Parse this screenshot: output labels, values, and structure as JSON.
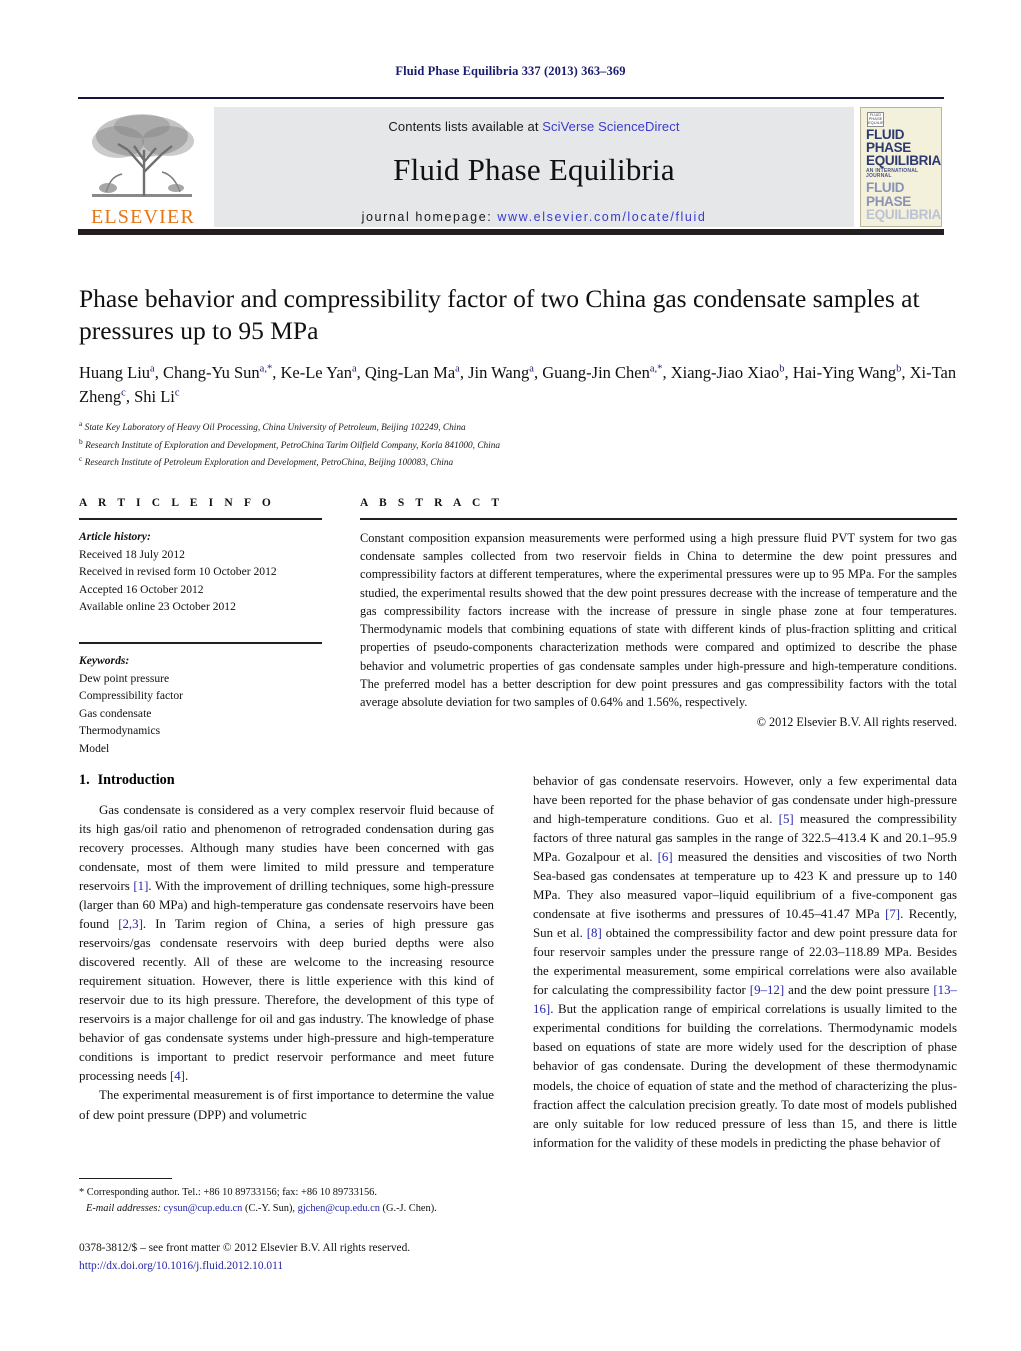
{
  "running_head": "Fluid Phase Equilibria 337 (2013) 363–369",
  "masthead": {
    "publisher_name": "ELSEVIER",
    "contents_prefix": "Contents lists available at ",
    "contents_link": "SciVerse ScienceDirect",
    "journal_title": "Fluid Phase Equilibria",
    "homepage_prefix": "journal homepage: ",
    "homepage_url": "www.elsevier.com/locate/fluid",
    "cover": {
      "badge_text": "FLUID PHASE EQUILIBRIA",
      "line1": "FLUID PHASE",
      "line2": "EQUILIBRIA",
      "subtitle": "AN INTERNATIONAL JOURNAL",
      "line3": "FLUID PHASE",
      "line4": "EQUILIBRIA"
    },
    "link_color": "#3b3bcc"
  },
  "article": {
    "title": "Phase behavior and compressibility factor of two China gas condensate samples at pressures up to 95 MPa",
    "authors_line1": "Huang Liu",
    "authors": "Huang Liu<sup>a</sup>, Chang-Yu Sun<sup>a,*</sup>, Ke-Le Yan<sup>a</sup>, Qing-Lan Ma<sup>a</sup>, Jin Wang<sup>a</sup>, Guang-Jin Chen<sup>a,*</sup>, Xiang-Jiao Xiao<sup>b</sup>, Hai-Ying Wang<sup>b</sup>, Xi-Tan Zheng<sup>c</sup>, Shi Li<sup>c</sup>",
    "affiliations": [
      "State Key Laboratory of Heavy Oil Processing, China University of Petroleum, Beijing 102249, China",
      "Research Institute of Exploration and Development, PetroChina Tarim Oilfield Company, Korla 841000, China",
      "Research Institute of Petroleum Exploration and Development, PetroChina, Beijing 100083, China"
    ],
    "affiliation_marks": [
      "a",
      "b",
      "c"
    ]
  },
  "article_info": {
    "heading": "A R T I C L E    I N F O",
    "history_label": "Article history:",
    "history": [
      "Received 18 July 2012",
      "Received in revised form 10 October 2012",
      "Accepted 16 October 2012",
      "Available online 23 October 2012"
    ],
    "keywords_label": "Keywords:",
    "keywords": [
      "Dew point pressure",
      "Compressibility factor",
      "Gas condensate",
      "Thermodynamics",
      "Model"
    ]
  },
  "abstract": {
    "heading": "A B S T R A C T",
    "text": "Constant composition expansion measurements were performed using a high pressure fluid PVT system for two gas condensate samples collected from two reservoir fields in China to determine the dew point pressures and compressibility factors at different temperatures, where the experimental pressures were up to 95 MPa. For the samples studied, the experimental results showed that the dew point pressures decrease with the increase of temperature and the gas compressibility factors increase with the increase of pressure in single phase zone at four temperatures. Thermodynamic models that combining equations of state with different kinds of plus-fraction splitting and critical properties of pseudo-components characterization methods were compared and optimized to describe the phase behavior and volumetric properties of gas condensate samples under high-pressure and high-temperature conditions. The preferred model has a better description for dew point pressures and gas compressibility factors with the total average absolute deviation for two samples of 0.64% and 1.56%, respectively.",
    "copyright": "© 2012 Elsevier B.V. All rights reserved."
  },
  "introduction": {
    "number": "1.",
    "heading": "Introduction",
    "left_paragraph_1": "Gas condensate is considered as a very complex reservoir fluid because of its high gas/oil ratio and phenomenon of retrograded condensation during gas recovery processes. Although many studies have been concerned with gas condensate, most of them were limited to mild pressure and temperature reservoirs [1]. With the improvement of drilling techniques, some high-pressure (larger than 60 MPa) and high-temperature gas condensate reservoirs have been found [2,3]. In Tarim region of China, a series of high pressure gas reservoirs/gas condensate reservoirs with deep buried depths were also discovered recently. All of these are welcome to the increasing resource requirement situation. However, there is little experience with this kind of reservoir due to its high pressure. Therefore, the development of this type of reservoirs is a major challenge for oil and gas industry. The knowledge of phase behavior of gas condensate systems under high-pressure and high-temperature conditions is important to predict reservoir performance and meet future processing needs [4].",
    "left_paragraph_2": "The experimental measurement is of first importance to determine the value of dew point pressure (DPP) and volumetric",
    "right_paragraph_1": "behavior of gas condensate reservoirs. However, only a few experimental data have been reported for the phase behavior of gas condensate under high-pressure and high-temperature conditions. Guo et al. [5] measured the compressibility factors of three natural gas samples in the range of 322.5–413.4 K and 20.1–95.9 MPa. Gozalpour et al. [6] measured the densities and viscosities of two North Sea-based gas condensates at temperature up to 423 K and pressure up to 140 MPa. They also measured vapor–liquid equilibrium of a five-component gas condensate at five isotherms and pressures of 10.45–41.47 MPa [7]. Recently, Sun et al. [8] obtained the compressibility factor and dew point pressure data for four reservoir samples under the pressure range of 22.03–118.89 MPa. Besides the experimental measurement, some empirical correlations were also available for calculating the compressibility factor [9–12] and the dew point pressure [13–16]. But the application range of empirical correlations is usually limited to the experimental conditions for building the correlations. Thermodynamic models based on equations of state are more widely used for the description of phase behavior of gas condensate. During the development of these thermodynamic models, the choice of equation of state and the method of characterizing the plus-fraction affect the calculation precision greatly. To date most of models published are only suitable for low reduced pressure of less than 15, and there is little information for the validity of these models in predicting the phase behavior of"
  },
  "footnote": {
    "corresponding": "* Corresponding author. Tel.: +86 10 89733156; fax: +86 10 89733156.",
    "email_label": "E-mail addresses:",
    "email_1": "cysun@cup.edu.cn",
    "email_1_name": "(C.-Y. Sun),",
    "email_2": "gjchen@cup.edu.cn",
    "email_2_name": "(G.-J. Chen)."
  },
  "colophon": {
    "issn_line": "0378-3812/$ – see front matter © 2012 Elsevier B.V. All rights reserved.",
    "doi": "http://dx.doi.org/10.1016/j.fluid.2012.10.011"
  }
}
